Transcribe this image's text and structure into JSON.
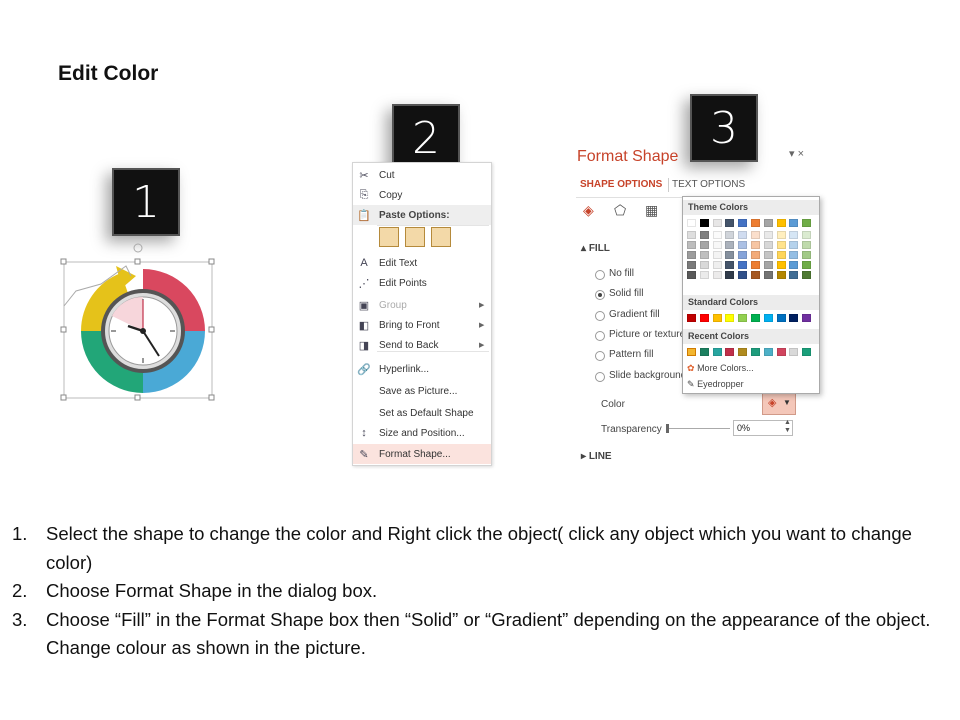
{
  "title": "Edit Color",
  "badges": [
    "1",
    "2",
    "3"
  ],
  "context_menu": {
    "items": [
      {
        "label": "Cut",
        "icon": "scissors-icon",
        "glyph": "✂",
        "type": "normal"
      },
      {
        "label": "Copy",
        "icon": "copy-icon",
        "glyph": "⎘",
        "type": "normal"
      },
      {
        "label": "Paste Options:",
        "icon": "paste-icon",
        "glyph": "📋",
        "type": "header"
      },
      {
        "label": "Edit Text",
        "icon": "edit-text-icon",
        "glyph": "A",
        "type": "normal"
      },
      {
        "label": "Edit Points",
        "icon": "edit-points-icon",
        "glyph": "⋰",
        "type": "normal"
      },
      {
        "label": "Group",
        "icon": "group-icon",
        "glyph": "▣",
        "type": "disabled",
        "submenu": true
      },
      {
        "label": "Bring to Front",
        "icon": "bring-to-front-icon",
        "glyph": "◧",
        "type": "normal",
        "submenu": true
      },
      {
        "label": "Send to Back",
        "icon": "send-to-back-icon",
        "glyph": "◨",
        "type": "normal",
        "submenu": true
      },
      {
        "label": "Hyperlink...",
        "icon": "hyperlink-icon",
        "glyph": "🔗",
        "type": "normal"
      },
      {
        "label": "Save as Picture...",
        "icon": "",
        "glyph": "",
        "type": "normal"
      },
      {
        "label": "Set as Default Shape",
        "icon": "",
        "glyph": "",
        "type": "normal"
      },
      {
        "label": "Size and Position...",
        "icon": "size-position-icon",
        "glyph": "↕",
        "type": "normal"
      },
      {
        "label": "Format Shape...",
        "icon": "format-shape-icon",
        "glyph": "✎",
        "type": "selected"
      }
    ]
  },
  "format_pane": {
    "title": "Format Shape",
    "controls": "▾ ×",
    "tabs": [
      "SHAPE OPTIONS",
      "TEXT OPTIONS"
    ],
    "fill_section": "FILL",
    "line_section": "LINE",
    "fill_options": [
      {
        "label": "No fill",
        "checked": false
      },
      {
        "label": "Solid fill",
        "checked": true
      },
      {
        "label": "Gradient fill",
        "checked": false
      },
      {
        "label": "Picture or texture fill",
        "checked": false
      },
      {
        "label": "Pattern fill",
        "checked": false
      },
      {
        "label": "Slide background fill",
        "checked": false
      }
    ],
    "color_label": "Color",
    "transparency_label": "Transparency",
    "transparency_value": "0%"
  },
  "color_picker": {
    "theme_header": "Theme Colors",
    "standard_header": "Standard Colors",
    "recent_header": "Recent Colors",
    "more_colors": "More Colors...",
    "eyedropper": "Eyedropper",
    "theme_top": [
      "#ffffff",
      "#000000",
      "#e7e6e6",
      "#44546a",
      "#4472c4",
      "#ed7d31",
      "#a5a5a5",
      "#ffc000",
      "#5b9bd5",
      "#70ad47"
    ],
    "standard": [
      "#c00000",
      "#ff0000",
      "#ffc000",
      "#ffff00",
      "#92d050",
      "#00b050",
      "#00b0f0",
      "#0070c0",
      "#002060",
      "#7030a0"
    ],
    "recent": [
      "#f2b630",
      "#1b7f5f",
      "#27a5a0",
      "#c0304a",
      "#b08b1e",
      "#1e9c7c",
      "#4db0c7",
      "#d1445e",
      "#d9d9d9",
      "#1a9f7a"
    ]
  },
  "instructions": [
    {
      "num": "1.",
      "text": "Select the shape to change the color and Right click the object( click any object which you want to change color)"
    },
    {
      "num": "2.",
      "text": "Choose Format Shape in the dialog box."
    },
    {
      "num": "3.",
      "text": "Choose “Fill” in the Format Shape box then “Solid” or “Gradient” depending on the appearance of the object. Change colour as shown in the picture."
    }
  ]
}
